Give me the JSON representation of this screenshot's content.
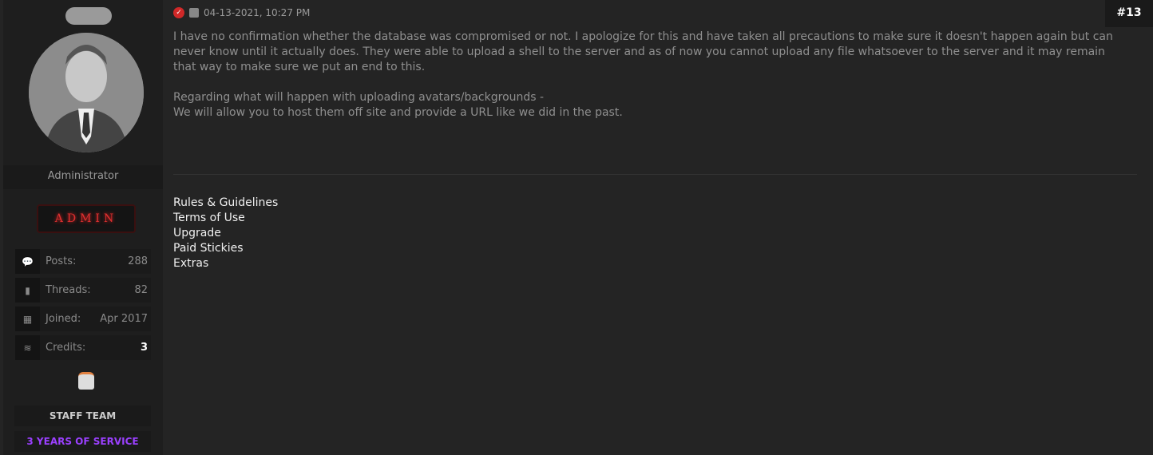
{
  "user": {
    "role": "Administrator",
    "badge": "ADMIN",
    "stats": [
      {
        "icon": "comments-icon",
        "label": "Posts:",
        "value": "288"
      },
      {
        "icon": "book-icon",
        "label": "Threads:",
        "value": "82"
      },
      {
        "icon": "calendar-icon",
        "label": "Joined:",
        "value": "Apr 2017"
      },
      {
        "icon": "coins-icon",
        "label": "Credits:",
        "value": "3"
      }
    ],
    "group": "STAFF TEAM",
    "service": "3 YEARS OF SERVICE",
    "service_color": "#9b40ff"
  },
  "post": {
    "date": "04-13-2021, 10:27 PM",
    "number": "#13",
    "paragraphs": [
      "I have no confirmation whether the database was compromised or not. I apologize for this and have taken all precautions to make sure it doesn't happen again but can never know until it actually does. They were able to upload a shell to the server and as of now you cannot upload any file whatsoever to the server and it may remain that way to make sure we put an end to this.",
      "Regarding what will happen with uploading avatars/backgrounds -\nWe will allow you to host them off site and provide a URL like we did in the past."
    ],
    "signature_links": [
      "Rules & Guidelines",
      "Terms of Use",
      "Upgrade",
      "Paid Stickies",
      "Extras"
    ]
  }
}
